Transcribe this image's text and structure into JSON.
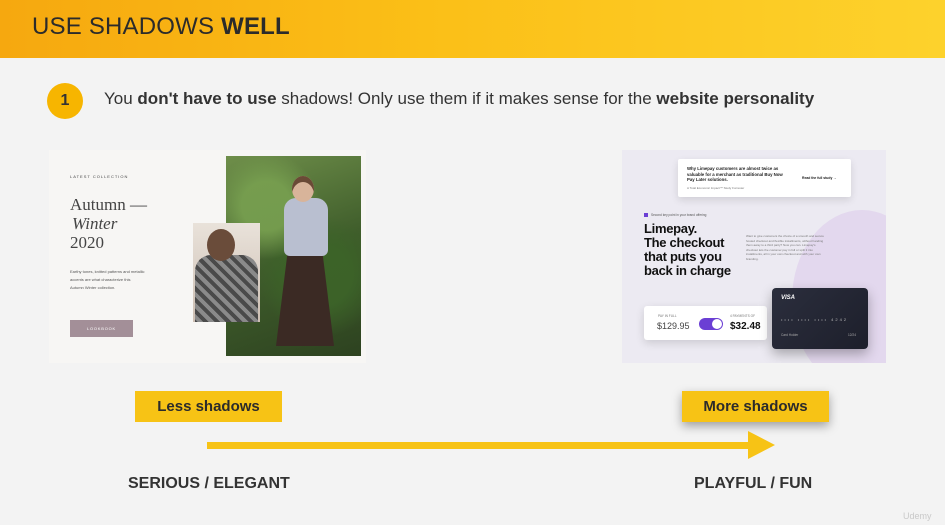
{
  "header": {
    "title_regular": "USE SHADOWS",
    "title_bold": "WELL"
  },
  "point": {
    "number": "1",
    "t1": "You ",
    "b1": "don't have to use",
    "t2": " shadows! Only use them if it makes sense for the ",
    "b2": "website personality"
  },
  "left_example": {
    "kicker": "LATEST COLLECTION",
    "title_line1": "Autumn —",
    "title_line2": "Winter",
    "title_line3": "2020",
    "description": "Earthy tones, knitted patterns and metallic accents are what characterize this Autumn Winter collection.",
    "button": "LOOKBOOK"
  },
  "right_example": {
    "top_card_text": "Why Limepay customers are almost twice as valuable for a merchant as traditional Buy Now Pay Later solutions.",
    "top_card_sub": "A Total Economic Impact™ Study Forrester",
    "top_card_link": "Read the full study  →",
    "kicker": "Second key point in your brand offering",
    "headline_1": "Limepay.",
    "headline_2": "The checkout",
    "headline_3": "that puts you",
    "headline_4": "back in charge",
    "paragraph": "Want to give customers the choice of a smooth and secure hosted checkout and flexible installments, without handing them away to a third party? Now you can. Limepay's checkout lets the customer pay in full or split it into installments, all in your own checkout and with your own branding.",
    "pay_full_label": "PAY IN FULL",
    "pay_full_amount": "$129.95",
    "installments_label": "4 PAYMENTS OF",
    "installments_amount": "$32.48",
    "card_brand": "VISA",
    "card_number": "•••• •••• •••• 4242",
    "card_name": "Card Holder",
    "card_expiry": "12/24"
  },
  "labels": {
    "less": "Less shadows",
    "more": "More shadows"
  },
  "scale": {
    "left": "SERIOUS / ELEGANT",
    "right": "PLAYFUL / FUN"
  },
  "watermark": "Udemy",
  "colors": {
    "accent": "#f7c315",
    "header_start": "#f6a80f",
    "header_end": "#fdd22c",
    "brand_purple": "#6b3fd4"
  }
}
